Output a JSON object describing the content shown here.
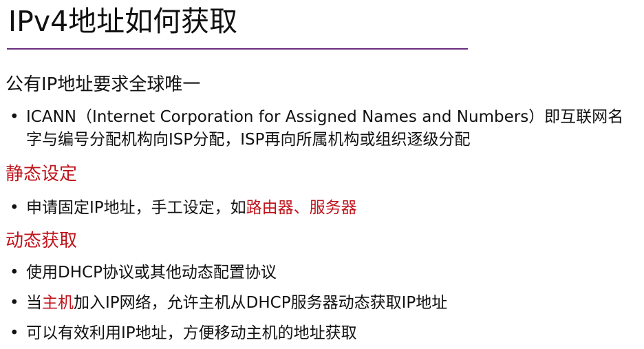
{
  "title": "IPv4地址如何获取",
  "section_public": {
    "heading": "公有IP地址要求全球唯一",
    "bullet1": "ICANN（Internet Corporation for Assigned Names and Numbers）即互联网名字与编号分配机构向ISP分配，ISP再向所属机构或组织逐级分配"
  },
  "section_static": {
    "heading": "静态设定",
    "bullet1_prefix": "申请固定IP地址，手工设定，如",
    "bullet1_highlight": "路由器、服务器"
  },
  "section_dynamic": {
    "heading": "动态获取",
    "bullet1": "使用DHCP协议或其他动态配置协议",
    "bullet2_prefix": "当",
    "bullet2_highlight": "主机",
    "bullet2_suffix": "加入IP网络，允许主机从DHCP服务器动态获取IP地址",
    "bullet3": "可以有效利用IP地址，方便移动主机的地址获取"
  },
  "bullet_symbol": "•",
  "colors": {
    "accent_line": "#6b2c7f",
    "highlight": "#c0141c",
    "text": "#111111"
  }
}
